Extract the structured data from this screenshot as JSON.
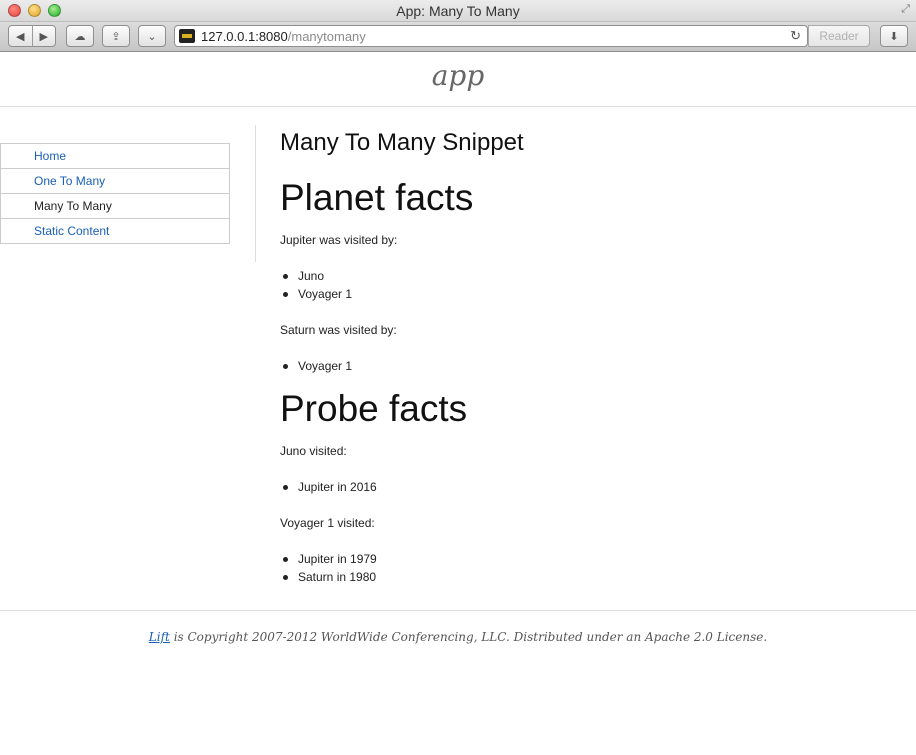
{
  "browser": {
    "window_title": "App: Many To Many",
    "url_host": "127.0.0.1:8080",
    "url_path": "/manytomany",
    "reader_label": "Reader",
    "icons": [
      "back-icon",
      "forward-icon",
      "cloud-icon",
      "share-icon",
      "pocket-icon",
      "reload-icon",
      "download-icon"
    ]
  },
  "site": {
    "logo": "app"
  },
  "sidebar": {
    "items": [
      {
        "label": "Home",
        "current": false
      },
      {
        "label": "One To Many",
        "current": false
      },
      {
        "label": "Many To Many",
        "current": true
      },
      {
        "label": "Static Content",
        "current": false
      }
    ]
  },
  "main": {
    "snippet_title": "Many To Many Snippet",
    "planet_section": {
      "title": "Planet facts",
      "groups": [
        {
          "heading": "Jupiter was visited by:",
          "items": [
            "Juno",
            "Voyager 1"
          ]
        },
        {
          "heading": "Saturn was visited by:",
          "items": [
            "Voyager 1"
          ]
        }
      ]
    },
    "probe_section": {
      "title": "Probe facts",
      "groups": [
        {
          "heading": "Juno visited:",
          "items": [
            "Jupiter in 2016"
          ]
        },
        {
          "heading": "Voyager 1 visited:",
          "items": [
            "Jupiter in 1979",
            "Saturn in 1980"
          ]
        }
      ]
    }
  },
  "footer": {
    "link_text": "Lift",
    "text": " is Copyright 2007-2012 WorldWide Conferencing, LLC. Distributed under an Apache 2.0 License."
  },
  "colors": {
    "link": "#1a5fb4",
    "text": "#222222",
    "rule": "#dddddd"
  }
}
